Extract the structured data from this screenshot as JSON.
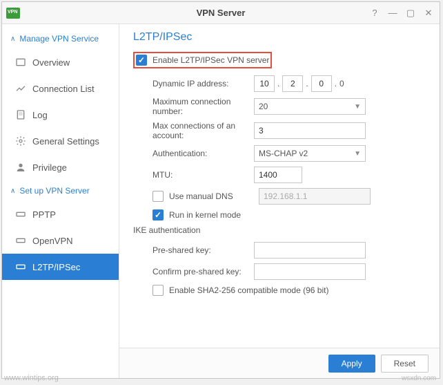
{
  "window": {
    "title": "VPN Server"
  },
  "sidebar": {
    "section1": {
      "label": "Manage VPN Service"
    },
    "section2": {
      "label": "Set up VPN Server"
    },
    "items": {
      "overview": "Overview",
      "connlist": "Connection List",
      "log": "Log",
      "general": "General Settings",
      "privilege": "Privilege",
      "pptp": "PPTP",
      "openvpn": "OpenVPN",
      "l2tp": "L2TP/IPSec"
    }
  },
  "page": {
    "title": "L2TP/IPSec",
    "enable_label": "Enable L2TP/IPSec VPN server",
    "dynamic_ip_label": "Dynamic IP address:",
    "ip": {
      "a": "10",
      "b": "2",
      "c": "0",
      "d": "0"
    },
    "max_conn_label": "Maximum connection number:",
    "max_conn_value": "20",
    "max_acct_label": "Max connections of an account:",
    "max_acct_value": "3",
    "auth_label": "Authentication:",
    "auth_value": "MS-CHAP v2",
    "mtu_label": "MTU:",
    "mtu_value": "1400",
    "manual_dns_label": "Use manual DNS",
    "manual_dns_value": "192.168.1.1",
    "kernel_label": "Run in kernel mode",
    "ike_label": "IKE authentication",
    "psk_label": "Pre-shared key:",
    "psk2_label": "Confirm pre-shared key:",
    "sha2_label": "Enable SHA2-256 compatible mode (96 bit)"
  },
  "footer": {
    "apply": "Apply",
    "reset": "Reset"
  },
  "watermark": "www.wintips.org",
  "watermark2": "wsxdn.com"
}
